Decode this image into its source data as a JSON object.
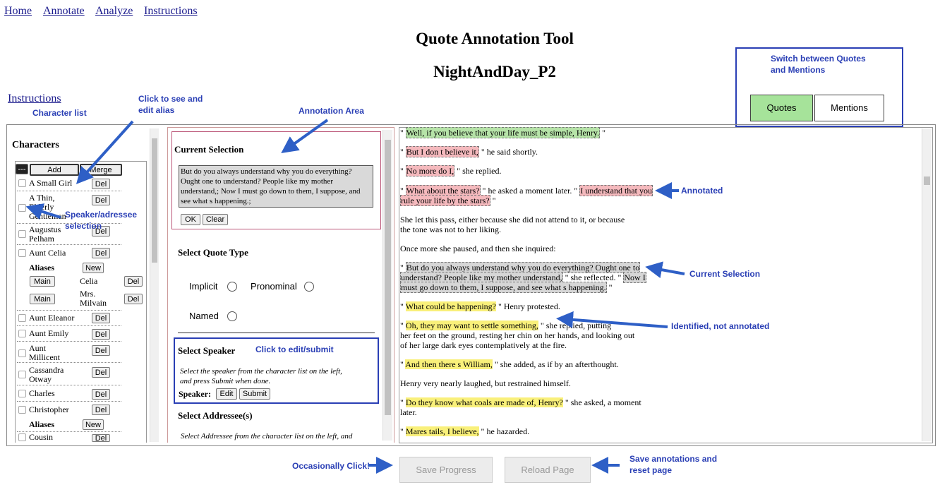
{
  "nav": {
    "home": "Home",
    "annotate": "Annotate",
    "analyze": "Analyze",
    "instructions": "Instructions"
  },
  "header": {
    "title": "Quote Annotation Tool",
    "doc_name": "NightAndDay_P2"
  },
  "instructions_link": "Instructions",
  "callouts": {
    "character_list": "Character list",
    "click_alias_1": "Click to see and",
    "click_alias_2": "edit alias",
    "annotation_area": "Annotation Area",
    "switch_1": "Switch between Quotes",
    "switch_2": "and Mentions",
    "speaker_sel_1": "Speaker/adressee",
    "speaker_sel_2": "selection",
    "click_edit": "Click to edit/submit",
    "annotated": "Annotated",
    "current_selection": "Current Selection",
    "identified": "Identified, not annotated",
    "occasionally": "Occasionally Click!",
    "save_1": "Save annotations and",
    "save_2": "reset page"
  },
  "mode": {
    "quotes": "Quotes",
    "mentions": "Mentions"
  },
  "characters": {
    "heading": "Characters",
    "dash": "---",
    "add": "Add",
    "merge": "Merge",
    "del": "Del",
    "new": "New",
    "main": "Main",
    "aliases": "Aliases",
    "list": {
      "small_girl": "A Small Girl",
      "thin_1": "A Thin,",
      "thin_2": "Elderly",
      "thin_3": "Gentleman",
      "augustus_1": "Augustus",
      "augustus_2": "Pelham",
      "celia": "Aunt Celia",
      "alias_celia": "Celia",
      "alias_milvain_1": "Mrs.",
      "alias_milvain_2": "Milvain",
      "eleanor": "Aunt Eleanor",
      "emily": "Aunt Emily",
      "millicent_1": "Aunt",
      "millicent_2": "Millicent",
      "cassandra_1": "Cassandra",
      "cassandra_2": "Otway",
      "charles": "Charles",
      "christopher": "Christopher",
      "cousin": "Cousin"
    }
  },
  "annotation": {
    "current_selection_heading": "Current Selection",
    "selection_text": "But do you always understand why you do everything? Ought one to understand? People like my mother understand,; Now I must go down to them, I suppose, and see what s happening.;",
    "ok": "OK",
    "clear": "Clear",
    "quote_type_heading": "Select Quote Type",
    "implicit": "Implicit",
    "pronominal": "Pronominal",
    "named": "Named",
    "speaker_heading": "Select Speaker",
    "speaker_hint_1": "Select the speaker from the character list on the left,",
    "speaker_hint_2": "and press Submit when done.",
    "speaker_label": "Speaker:",
    "edit": "Edit",
    "submit": "Submit",
    "addressee_heading": "Select Addressee(s)",
    "addressee_hint": "Select Addressee from the character list on the left, and"
  },
  "text": {
    "l1a": "\" ",
    "l1b": "Well, if you believe that your life must be simple, Henry.",
    "l1c": " \"",
    "l2a": "\" ",
    "l2b": "But I don t believe it,",
    "l2c": " \" he said shortly.",
    "l3a": "\" ",
    "l3b": "No more do I,",
    "l3c": " \" she replied.",
    "l4a": "\" ",
    "l4b": "What about the stars?",
    "l4c": " \" he asked a moment later. \" ",
    "l4d": "I understand that you",
    "l5a": "rule your life by the stars?",
    "l5b": " \"",
    "l6": "She let this pass, either because she did not attend to it, or because",
    "l7": "the tone was not to her liking.",
    "l8": "Once more she paused, and then she inquired:",
    "l9a": "\" ",
    "l9b": "But do you always understand why you do everything? Ought one to",
    "l10a": "understand? People like my mother understand,",
    "l10b": " \" she reflected. \" ",
    "l10c": "Now I",
    "l11a": "must go down to them, I suppose, and see what s happening.",
    "l11b": " \"",
    "l12a": "\" ",
    "l12b": "What could be happening?",
    "l12c": " \" Henry protested.",
    "l13a": "\" ",
    "l13b": "Oh, they may want to settle something,",
    "l13c": " \" she replied, putting",
    "l14": "her feet on the ground, resting her chin on her hands, and looking out",
    "l15": "of her large dark eyes contemplatively at the fire.",
    "l16a": "\" ",
    "l16b": "And then there s William,",
    "l16c": " \" she added, as if by an afterthought.",
    "l17": "Henry very nearly laughed, but restrained himself.",
    "l18a": "\" ",
    "l18b": "Do they know what coals are made of, Henry?",
    "l18c": " \" she asked, a moment",
    "l19": "later.",
    "l20a": "\" ",
    "l20b": "Mares  tails, I believe,",
    "l20c": " \" he hazarded."
  },
  "footer": {
    "save": "Save Progress",
    "reload": "Reload Page"
  },
  "colors": {
    "callout": "#2a3fb5",
    "arrow": "#2e5fc6",
    "quotes_active": "#a6e39a",
    "annotated": "#f4b9bd",
    "identified": "#f9f07a",
    "current": "#d6d6d6"
  }
}
